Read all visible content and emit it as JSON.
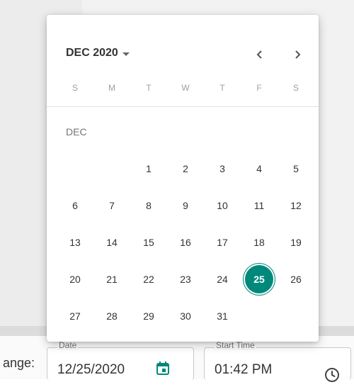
{
  "datepicker": {
    "month_year": "DEC 2020",
    "month_label": "DEC",
    "weekdays": [
      "S",
      "M",
      "T",
      "W",
      "T",
      "F",
      "S"
    ],
    "weeks": [
      [
        "",
        "",
        "1",
        "2",
        "3",
        "4",
        "5"
      ],
      [
        "6",
        "7",
        "8",
        "9",
        "10",
        "11",
        "12"
      ],
      [
        "13",
        "14",
        "15",
        "16",
        "17",
        "18",
        "19"
      ],
      [
        "20",
        "21",
        "22",
        "23",
        "24",
        "25",
        "26"
      ],
      [
        "27",
        "28",
        "29",
        "30",
        "31",
        "",
        ""
      ]
    ],
    "selected_day": "25",
    "prev_icon": "chevron-left-icon",
    "next_icon": "chevron-right-icon",
    "accent_color": "#00897b"
  },
  "form": {
    "range_label": "ange:",
    "date_field": {
      "label": "Date",
      "value": "12/25/2020",
      "icon": "calendar-icon"
    },
    "time_field": {
      "label": "Start Time",
      "value": "01:42 PM",
      "icon": "clock-icon"
    }
  }
}
